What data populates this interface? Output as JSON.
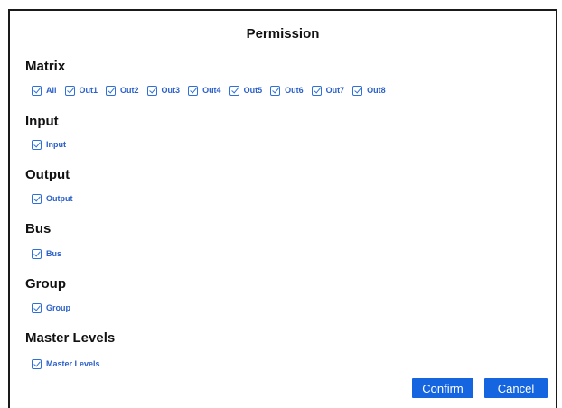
{
  "dialog": {
    "title": "Permission"
  },
  "sections": {
    "matrix": {
      "title": "Matrix",
      "items": [
        "All",
        "Out1",
        "Out2",
        "Out3",
        "Out4",
        "Out5",
        "Out6",
        "Out7",
        "Out8"
      ]
    },
    "input": {
      "title": "Input",
      "item": "Input"
    },
    "output": {
      "title": "Output",
      "item": "Output"
    },
    "bus": {
      "title": "Bus",
      "item": "Bus"
    },
    "group": {
      "title": "Group",
      "item": "Group"
    },
    "master": {
      "title": "Master Levels",
      "item": "Master Levels"
    }
  },
  "buttons": {
    "confirm": "Confirm",
    "cancel": "Cancel"
  },
  "colors": {
    "accent": "#1565e0",
    "checkbox": "#2f6fd6",
    "label": "#2a5fc9"
  },
  "icons": {
    "checkbox": "checkbox-checked-icon"
  }
}
